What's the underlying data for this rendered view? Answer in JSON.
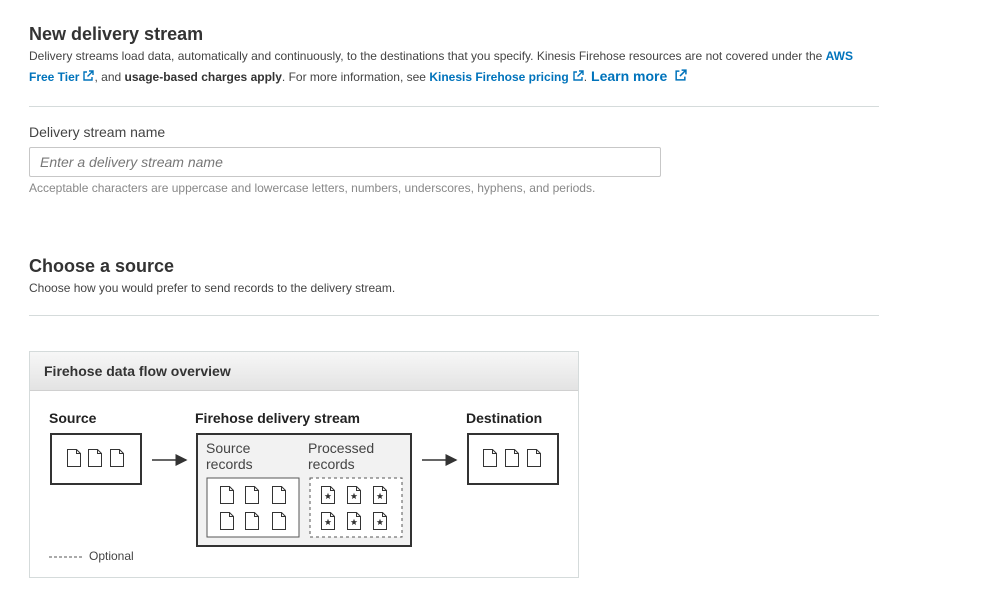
{
  "delivery": {
    "title": "New delivery stream",
    "desc_prefix": "Delivery streams load data, automatically and continuously, to the destinations that you specify. Kinesis Firehose resources are not covered under the ",
    "free_tier_link": "AWS Free Tier",
    "desc_middle": ", and ",
    "usage_charges": "usage-based charges apply",
    "desc_more": ". For more information, see ",
    "pricing_link": "Kinesis Firehose pricing",
    "desc_end": ".",
    "learn_more": "Learn more",
    "name_label": "Delivery stream name",
    "name_value": "",
    "name_placeholder": "Enter a delivery stream name",
    "name_hint": "Acceptable characters are uppercase and lowercase letters, numbers, underscores, hyphens, and periods."
  },
  "source_section": {
    "title": "Choose a source",
    "description": "Choose how you would prefer to send records to the delivery stream."
  },
  "overview": {
    "header": "Firehose data flow overview",
    "source_label": "Source",
    "stream_label": "Firehose delivery stream",
    "destination_label": "Destination",
    "source_records_label": "Source records",
    "processed_records_label": "Processed records",
    "legend_label": "Optional"
  },
  "colors": {
    "link": "#0073bb",
    "divider": "#d5dbdb",
    "panel_border": "#d5dbdb"
  }
}
